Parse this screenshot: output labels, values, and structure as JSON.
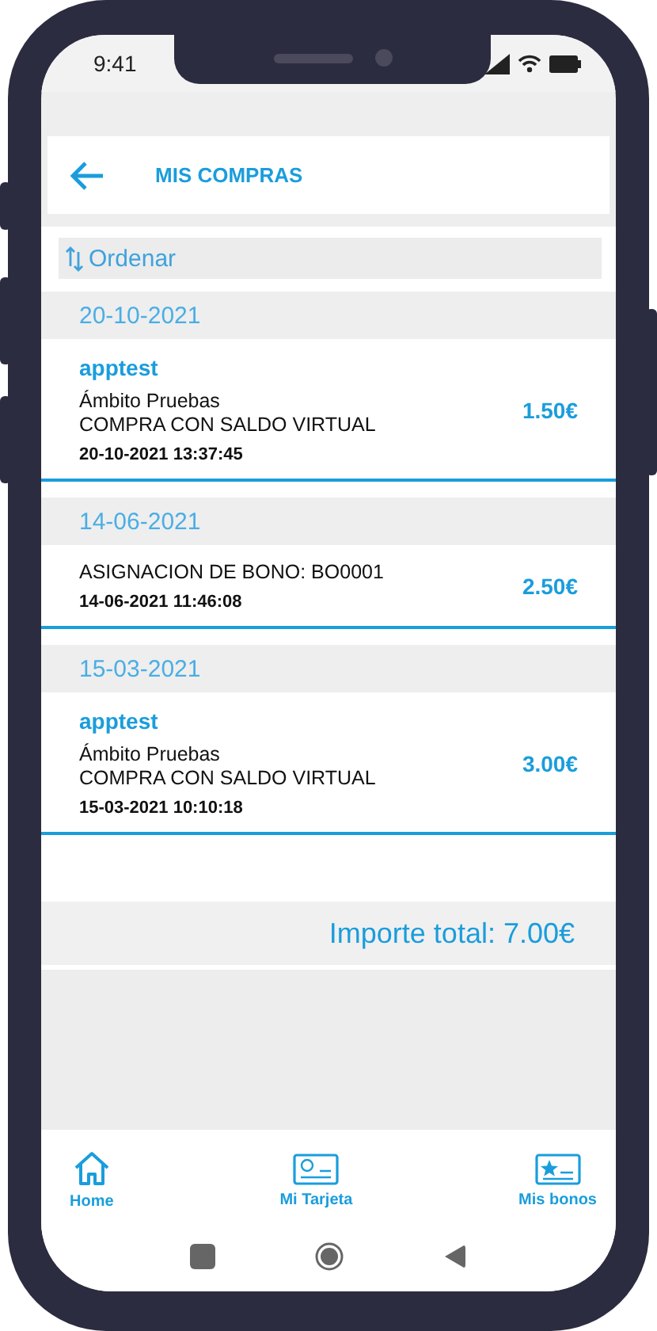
{
  "status_bar": {
    "time": "9:41"
  },
  "header": {
    "title": "MIS COMPRAS"
  },
  "sort": {
    "label": "Ordenar"
  },
  "groups": [
    {
      "date": "20-10-2021",
      "items": [
        {
          "merchant": "apptest",
          "area": "Ámbito Pruebas",
          "concept": "COMPRA CON SALDO VIRTUAL",
          "timestamp": "20-10-2021 13:37:45",
          "amount": "1.50€"
        }
      ]
    },
    {
      "date": "14-06-2021",
      "items": [
        {
          "concept": "ASIGNACION DE BONO: BO0001",
          "timestamp": "14-06-2021 11:46:08",
          "amount": "2.50€"
        }
      ]
    },
    {
      "date": "15-03-2021",
      "items": [
        {
          "merchant": "apptest",
          "area": "Ámbito Pruebas",
          "concept": "COMPRA CON SALDO VIRTUAL",
          "timestamp": "15-03-2021 10:10:18",
          "amount": "3.00€"
        }
      ]
    }
  ],
  "total": "Importe total: 7.00€",
  "bottom_nav": [
    {
      "label": "Home",
      "kind": "home"
    },
    {
      "label": "Mi Tarjeta",
      "kind": "card"
    },
    {
      "label": "Mis bonos",
      "kind": "voucher"
    }
  ]
}
